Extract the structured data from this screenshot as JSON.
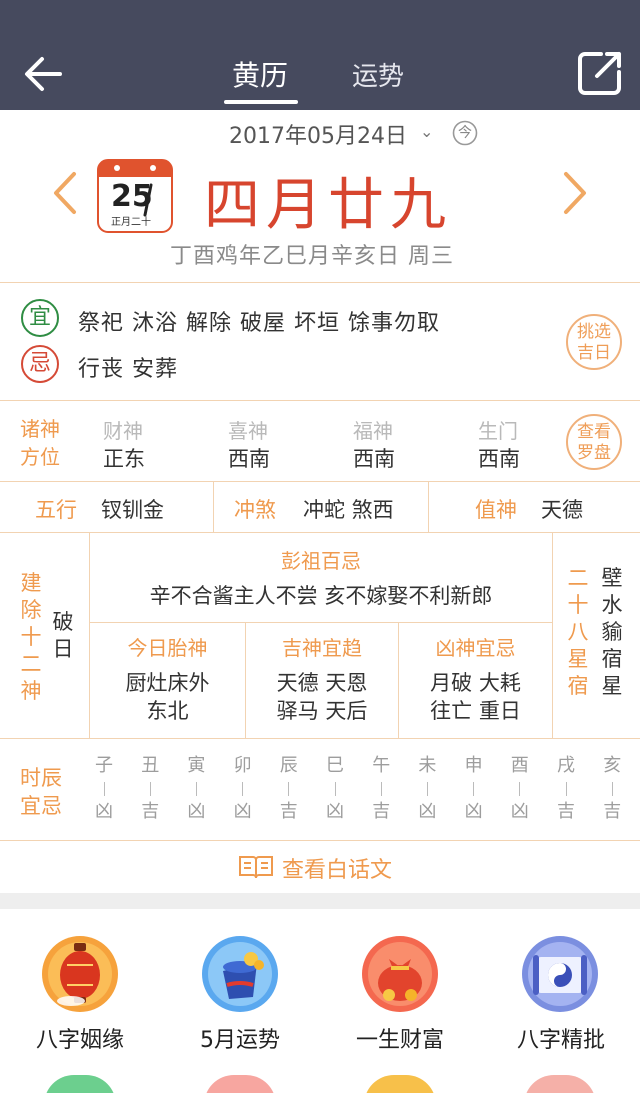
{
  "header": {
    "tabs": [
      {
        "label": "黄历",
        "active": true
      },
      {
        "label": "运势",
        "active": false
      }
    ],
    "bg_color": "#464a5e"
  },
  "date": {
    "gregorian": "2017年05月24日",
    "today_badge": "今",
    "lunar": "四月廿九",
    "ganzhi": "丁酉鸡年乙巳月辛亥日 周三",
    "calendar_icon_day": "25",
    "calendar_icon_sub": "正月二十"
  },
  "yiji": {
    "yi_badge": "宜",
    "yi_text": "祭祀 沐浴 解除 破屋 坏垣 馀事勿取",
    "ji_badge": "忌",
    "ji_text": "行丧 安葬",
    "pick_button": [
      "挑选",
      "吉日"
    ]
  },
  "gods": {
    "label": [
      "诸神",
      "方位"
    ],
    "items": [
      {
        "name": "财神",
        "dir": "正东"
      },
      {
        "name": "喜神",
        "dir": "西南"
      },
      {
        "name": "福神",
        "dir": "西南"
      },
      {
        "name": "生门",
        "dir": "西南"
      }
    ],
    "compass_button": [
      "查看",
      "罗盘"
    ]
  },
  "elements": {
    "wuxing_label": "五行",
    "wuxing_value": "钗钏金",
    "chongsha_label": "冲煞",
    "chongsha_value": "冲蛇 煞西",
    "zhishen_label": "值神",
    "zhishen_value": "天德"
  },
  "detail": {
    "jianchu_label": "建除十二神",
    "jianchu_value": "破日",
    "pengzu_title": "彭祖百忌",
    "pengzu_text": "辛不合酱主人不尝 亥不嫁娶不利新郎",
    "taishen_title": "今日胎神",
    "taishen_lines": [
      "厨灶床外",
      "东北"
    ],
    "jishen_title": "吉神宜趋",
    "jishen_lines": [
      "天德 天恩",
      "驿马 天后"
    ],
    "xiongshen_title": "凶神宜忌",
    "xiongshen_lines": [
      "月破 大耗",
      "往亡 重日"
    ],
    "xingsu_label": "二十八星宿",
    "xingsu_value": "壁水貐宿星"
  },
  "hours": {
    "label": [
      "时辰",
      "宜忌"
    ],
    "items": [
      {
        "zhi": "子",
        "luck": "凶"
      },
      {
        "zhi": "丑",
        "luck": "吉"
      },
      {
        "zhi": "寅",
        "luck": "凶"
      },
      {
        "zhi": "卯",
        "luck": "凶"
      },
      {
        "zhi": "辰",
        "luck": "吉"
      },
      {
        "zhi": "巳",
        "luck": "凶"
      },
      {
        "zhi": "午",
        "luck": "吉"
      },
      {
        "zhi": "未",
        "luck": "凶"
      },
      {
        "zhi": "申",
        "luck": "凶"
      },
      {
        "zhi": "酉",
        "luck": "凶"
      },
      {
        "zhi": "戌",
        "luck": "吉"
      },
      {
        "zhi": "亥",
        "luck": "吉"
      }
    ]
  },
  "plain_text_link": "查看白话文",
  "services": [
    {
      "label": "八字姻缘",
      "icon": "lantern-icon"
    },
    {
      "label": "5月运势",
      "icon": "treasure-pot-icon"
    },
    {
      "label": "一生财富",
      "icon": "money-bag-icon"
    },
    {
      "label": "八字精批",
      "icon": "bagua-scroll-icon"
    }
  ],
  "colors": {
    "accent_orange": "#ef9a4e",
    "lunar_red": "#d7452e",
    "yi_green": "#2f8d43",
    "ji_red": "#d54a37",
    "divider": "#f2d3b2"
  }
}
